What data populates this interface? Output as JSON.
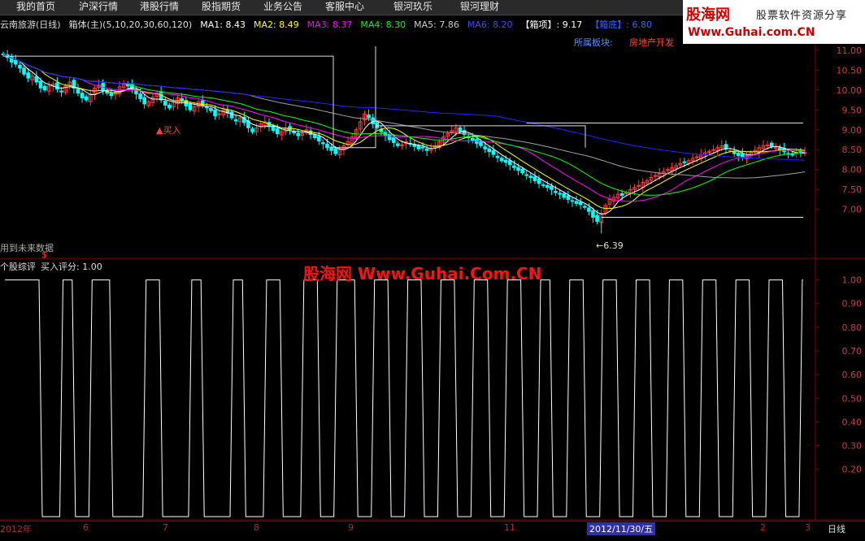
{
  "menu": [
    "我的首页",
    "沪深行情",
    "港股行情",
    "股指期货",
    "业务公告",
    "客服中心",
    "银河玖乐",
    "银河理财"
  ],
  "logo": {
    "brand": "股海网",
    "slogan": "股票软件资源分享",
    "url": "Www.Guhai.com.CN"
  },
  "infobar": {
    "stock": "云南旅游(日线)",
    "indicator": "箱体(主)(5,10,20,30,60,120)",
    "ma1": "MA1: 8.43",
    "ma2": "MA2: 8.49",
    "ma3": "MA3: 8.37",
    "ma4": "MA4: 8.30",
    "ma5": "MA5: 7.86",
    "ma6": "MA6: 8.20",
    "box_top": "【箱项】: 9.17",
    "box_bottom": "【箱底】: 6.80"
  },
  "sector": {
    "label": "所属板块:",
    "value": "房地产开发"
  },
  "annotations": {
    "buy": "▲买入",
    "low": "←6.39",
    "future_data": "用到未来数据",
    "future_mark": "$"
  },
  "watermark": "股海网 Www.Guhai.Com.CN",
  "sub_header": {
    "name": "个股综评",
    "score": "买入评分: 1.00"
  },
  "period": "日线",
  "date_marker": "2012/11/30/五",
  "colors": {
    "up": "#ff3b3b",
    "down": "#00ffff",
    "ma1": "#ffffff",
    "ma2": "#ffff00",
    "ma3": "#ff00ff",
    "ma4": "#00ff00",
    "ma5": "#9aa0a6",
    "ma6": "#2222ff",
    "axis": "#800000"
  },
  "chart_data": [
    {
      "type": "candlestick",
      "title": "云南旅游(日线)",
      "ylim": [
        6.3,
        11.2
      ],
      "yticks": [
        11.0,
        10.5,
        10.0,
        9.5,
        9.0,
        8.5,
        8.0,
        7.5,
        7.0
      ],
      "ytick_labels": [
        "11.00",
        "10.50",
        "10.00",
        "9.50",
        "9.00",
        "8.50",
        "8.00",
        "7.50",
        "7.00"
      ],
      "xtick_labels": [
        "2012年",
        "6",
        "7",
        "8",
        "9",
        "11",
        "2",
        "3"
      ],
      "close": [
        10.9,
        10.82,
        10.7,
        10.65,
        10.55,
        10.4,
        10.3,
        10.35,
        10.2,
        10.05,
        10.0,
        10.1,
        10.15,
        10.02,
        9.95,
        10.1,
        10.2,
        10.05,
        9.92,
        9.8,
        9.75,
        9.9,
        10.05,
        10.12,
        10.0,
        9.92,
        9.86,
        9.95,
        10.08,
        10.15,
        10.1,
        10.02,
        9.9,
        9.78,
        9.65,
        9.7,
        9.82,
        9.9,
        9.75,
        9.62,
        9.55,
        9.7,
        9.8,
        9.72,
        9.6,
        9.5,
        9.58,
        9.7,
        9.62,
        9.55,
        9.48,
        9.35,
        9.4,
        9.5,
        9.42,
        9.3,
        9.22,
        9.3,
        9.18,
        9.05,
        8.95,
        9.05,
        9.15,
        9.2,
        9.08,
        8.98,
        8.9,
        8.95,
        9.05,
        9.0,
        8.92,
        8.85,
        8.9,
        9.0,
        8.88,
        8.8,
        8.72,
        8.65,
        8.55,
        8.48,
        8.4,
        8.5,
        8.6,
        8.7,
        8.82,
        9.0,
        9.2,
        9.4,
        9.3,
        9.15,
        9.05,
        8.95,
        8.85,
        8.75,
        8.68,
        8.6,
        8.62,
        8.7,
        8.65,
        8.58,
        8.52,
        8.55,
        8.48,
        8.52,
        8.6,
        8.7,
        8.82,
        8.9,
        8.98,
        9.05,
        8.95,
        8.88,
        8.8,
        8.74,
        8.66,
        8.6,
        8.52,
        8.45,
        8.38,
        8.3,
        8.22,
        8.18,
        8.12,
        8.05,
        7.98,
        7.92,
        7.85,
        7.8,
        7.72,
        7.65,
        7.6,
        7.55,
        7.5,
        7.42,
        7.38,
        7.3,
        7.25,
        7.2,
        7.15,
        7.12,
        7.05,
        6.95,
        6.8,
        6.7,
        6.9,
        7.1,
        7.25,
        7.3,
        7.38,
        7.35,
        7.42,
        7.5,
        7.55,
        7.6,
        7.68,
        7.72,
        7.8,
        7.85,
        7.9,
        7.95,
        8.0,
        8.05,
        8.1,
        8.15,
        8.18,
        8.22,
        8.28,
        8.32,
        8.38,
        8.42,
        8.45,
        8.5,
        8.55,
        8.6,
        8.52,
        8.48,
        8.4,
        8.35,
        8.3,
        8.35,
        8.42,
        8.48,
        8.55,
        8.6,
        8.62,
        8.58,
        8.55,
        8.5,
        8.45,
        8.4,
        8.38,
        8.42,
        8.45,
        8.43
      ],
      "series": [
        {
          "name": "MA1",
          "value": 8.43
        },
        {
          "name": "MA2",
          "value": 8.49
        },
        {
          "name": "MA3",
          "value": 8.37
        },
        {
          "name": "MA4",
          "value": 8.3
        },
        {
          "name": "MA5",
          "value": 7.86
        },
        {
          "name": "MA6",
          "value": 8.2
        }
      ],
      "box_top": 9.17,
      "box_bottom": 6.8,
      "low_marker": 6.39
    },
    {
      "type": "step-line",
      "title": "个股综评",
      "ylim": [
        0.0,
        1.05
      ],
      "yticks": [
        1.0,
        0.9,
        0.8,
        0.7,
        0.6,
        0.5,
        0.4,
        0.3,
        0.2
      ],
      "ytick_labels": [
        "1.00",
        "0.90",
        "0.80",
        "0.70",
        "0.60",
        "0.50",
        "0.40",
        "0.30",
        "0.20"
      ],
      "x_segments_start": [
        0,
        9,
        14,
        17,
        21,
        26,
        34,
        38,
        45,
        48,
        55,
        58,
        63,
        67,
        72,
        76,
        80,
        85,
        89,
        93,
        97,
        101,
        105,
        109,
        113,
        117,
        121,
        125,
        129,
        132,
        136,
        140,
        144,
        148,
        152,
        156,
        160,
        164,
        168,
        172,
        176,
        180,
        184,
        188,
        192
      ],
      "values": [
        1,
        0,
        1,
        0,
        1,
        0,
        1,
        0,
        1,
        0,
        1,
        0,
        1,
        0,
        1,
        0,
        1,
        0,
        1,
        0,
        1,
        0,
        1,
        0,
        1,
        0,
        1,
        0,
        1,
        0,
        1,
        0,
        1,
        0,
        1,
        0,
        1,
        0,
        1,
        0,
        1,
        0,
        1,
        0,
        1
      ],
      "current": 1.0
    }
  ]
}
